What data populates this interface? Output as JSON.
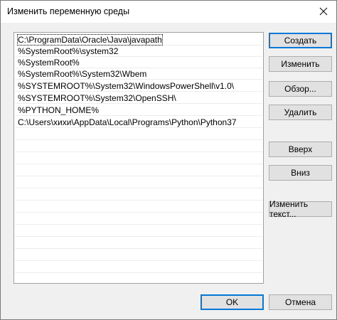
{
  "window": {
    "title": "Изменить переменную среды"
  },
  "list": {
    "items": [
      "C:\\ProgramData\\Oracle\\Java\\javapath",
      "%SystemRoot%\\system32",
      "%SystemRoot%",
      "%SystemRoot%\\System32\\Wbem",
      "%SYSTEMROOT%\\System32\\WindowsPowerShell\\v1.0\\",
      "%SYSTEMROOT%\\System32\\OpenSSH\\",
      "%PYTHON_HOME%",
      "C:\\Users\\хихи\\AppData\\Local\\Programs\\Python\\Python37"
    ]
  },
  "buttons": {
    "create": "Создать",
    "edit": "Изменить",
    "browse": "Обзор...",
    "delete": "Удалить",
    "up": "Вверх",
    "down": "Вниз",
    "edit_text": "Изменить текст...",
    "ok": "OK",
    "cancel": "Отмена"
  },
  "icons": {
    "close": "close-icon"
  },
  "colors": {
    "accent": "#0078d7"
  }
}
